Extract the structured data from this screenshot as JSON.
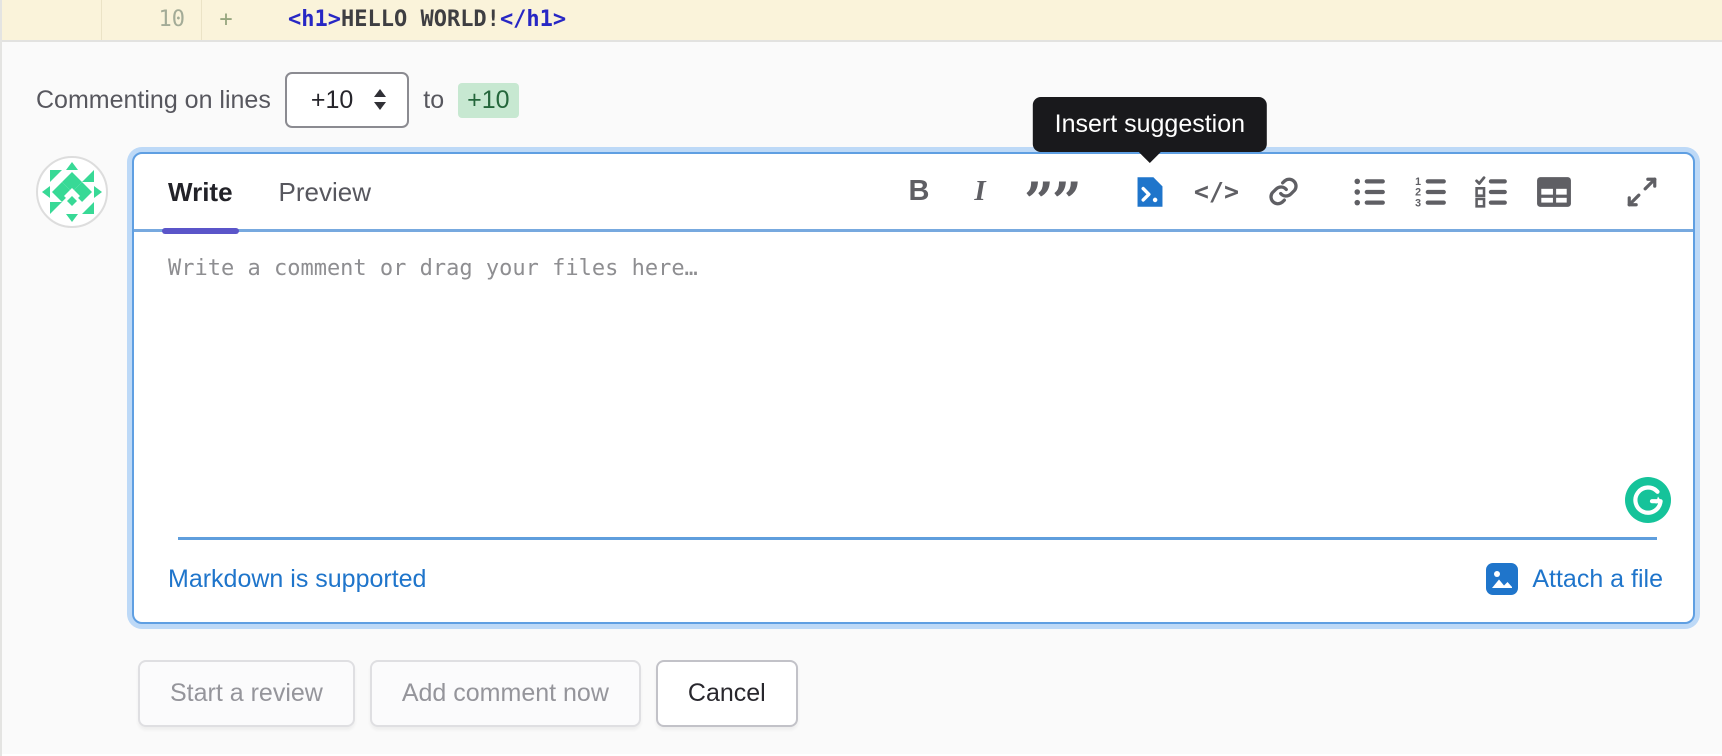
{
  "diff_line": {
    "new_line_number": "10",
    "change_sign": "+",
    "code": {
      "open_tag": "<h1>",
      "content": "HELLO WORLD!",
      "close_tag": "</h1>"
    }
  },
  "comment_header": {
    "label": "Commenting on lines",
    "start_line": "+10",
    "to_label": "to",
    "end_line": "+10"
  },
  "tooltip": {
    "label": "Insert suggestion"
  },
  "editor": {
    "tabs": {
      "write": "Write",
      "preview": "Preview"
    },
    "toolbar_glyphs": {
      "bold": "B",
      "italic": "I",
      "quote": "””",
      "code": "</>"
    },
    "placeholder": "Write a comment or drag your files here…",
    "footer": {
      "markdown_link": "Markdown is supported",
      "attach_link": "Attach a file"
    }
  },
  "actions": {
    "start_review": "Start a review",
    "add_comment": "Add comment now",
    "cancel": "Cancel"
  },
  "colors": {
    "accent_blue": "#1f75cb",
    "focus_ring": "#bdd9f7",
    "tab_underline": "#5b55c9",
    "added_line_bg": "#faf3da",
    "badge_green_bg": "#c7e8d1",
    "badge_green_text": "#24663b",
    "grammarly_green": "#15c39a",
    "avatar_green": "#38d996",
    "tooltip_bg": "#19191c"
  }
}
